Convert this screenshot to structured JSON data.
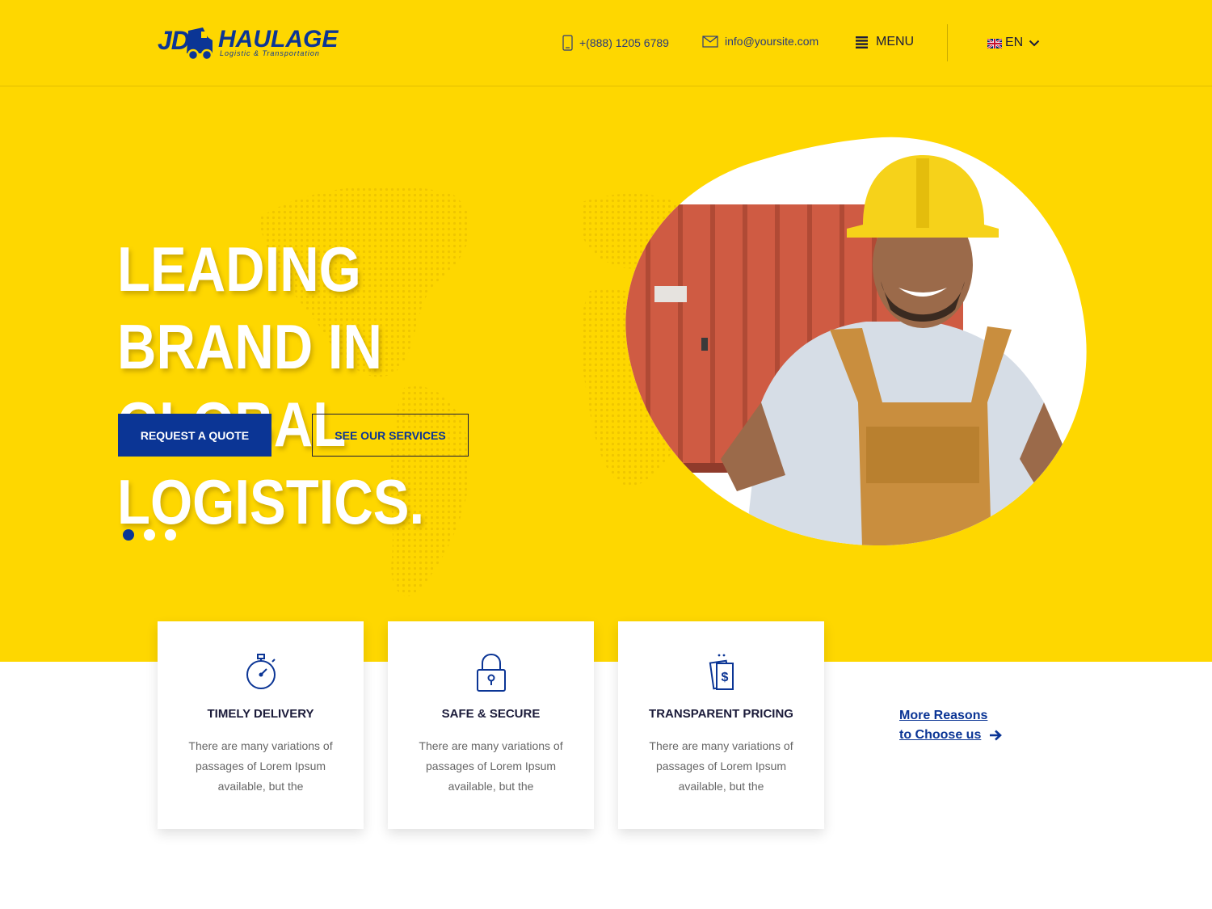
{
  "brand": {
    "logo_jd": "JD",
    "logo_name": "HAULAGE",
    "logo_tagline": "Logistic & Transportation"
  },
  "header": {
    "phone": "+(888) 1205 6789",
    "email": "info@yoursite.com",
    "menu_label": "MENU",
    "language": "EN"
  },
  "hero": {
    "title_line1": "LEADING BRAND IN",
    "title_line2": "GLOBAL LOGISTICS.",
    "primary_button": "REQUEST A QUOTE",
    "secondary_button": "SEE OUR SERVICES",
    "slides_total": 3,
    "active_slide": 1
  },
  "features": [
    {
      "title": "TIMELY DELIVERY",
      "text": "There are many variations of passages of Lorem Ipsum available, but the",
      "icon": "stopwatch-icon"
    },
    {
      "title": "SAFE & SECURE",
      "text": "There are many variations of passages of Lorem Ipsum available, but the",
      "icon": "padlock-icon"
    },
    {
      "title": "TRANSPARENT PRICING",
      "text": "There are many variations of passages of Lorem Ipsum available, but the",
      "icon": "money-icon"
    }
  ],
  "more_link": {
    "line1": "More Reasons",
    "line2": "to Choose us"
  },
  "colors": {
    "brand_yellow": "#fed700",
    "brand_blue": "#0b3595",
    "text_dark": "#1b1b3a"
  }
}
